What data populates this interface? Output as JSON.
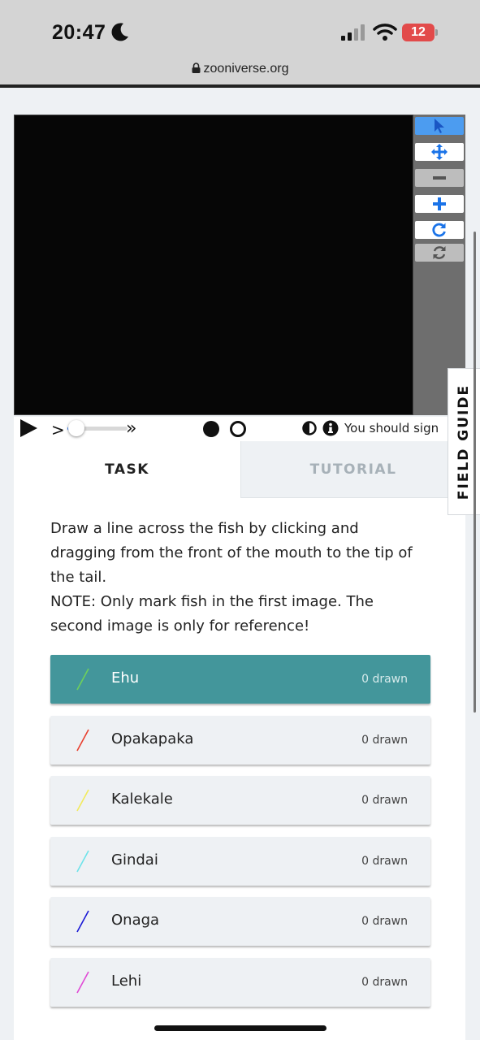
{
  "status": {
    "time": "20:47",
    "battery": "12",
    "moon_icon": "moon-icon",
    "signal_icon": "cellular-signal-icon",
    "wifi_icon": "wifi-icon"
  },
  "browser": {
    "url": "zooniverse.org",
    "lock_icon": "lock-icon"
  },
  "toolbar": {
    "tools": [
      {
        "name": "pointer",
        "icon": "cursor-arrow-icon",
        "state": "active"
      },
      {
        "name": "pan",
        "icon": "move-arrows-icon",
        "state": "normal"
      },
      {
        "name": "zoom-out",
        "icon": "minus-icon",
        "state": "disabled"
      },
      {
        "name": "zoom-in",
        "icon": "plus-icon",
        "state": "normal"
      },
      {
        "name": "rotate",
        "icon": "rotate-icon",
        "state": "normal"
      },
      {
        "name": "reset",
        "icon": "refresh-icon",
        "state": "disabled"
      }
    ]
  },
  "controls": {
    "play_icon": "play-icon",
    "step_forward": ">",
    "fast_forward": "»",
    "frame_progress": 0.15,
    "contrast_icon": "contrast-icon",
    "info_icon": "info-icon",
    "signin_notice": "You should sign"
  },
  "tabs": {
    "task": "TASK",
    "tutorial": "TUTORIAL"
  },
  "task": {
    "instructions": [
      "Draw a line across the fish by clicking and",
      "dragging from the front of the mouth to the tip of",
      "the tail.",
      "NOTE: Only mark fish in the first image. The",
      "second image is only for reference!"
    ],
    "choices": [
      {
        "label": "Ehu",
        "count": "0 drawn",
        "color": "#6fd15a",
        "selected": true
      },
      {
        "label": "Opakapaka",
        "count": "0 drawn",
        "color": "#e8402f",
        "selected": false
      },
      {
        "label": "Kalekale",
        "count": "0 drawn",
        "color": "#f2ea5c",
        "selected": false
      },
      {
        "label": "Gindai",
        "count": "0 drawn",
        "color": "#6ee3ea",
        "selected": false
      },
      {
        "label": "Onaga",
        "count": "0 drawn",
        "color": "#1a1ad6",
        "selected": false
      },
      {
        "label": "Lehi",
        "count": "0 drawn",
        "color": "#e04ad6",
        "selected": false
      }
    ]
  },
  "field_guide": {
    "label": "FIELD GUIDE"
  },
  "colors": {
    "accent": "#43969b",
    "active_tool": "#4c9cf0",
    "slider": "#3b82f6"
  }
}
